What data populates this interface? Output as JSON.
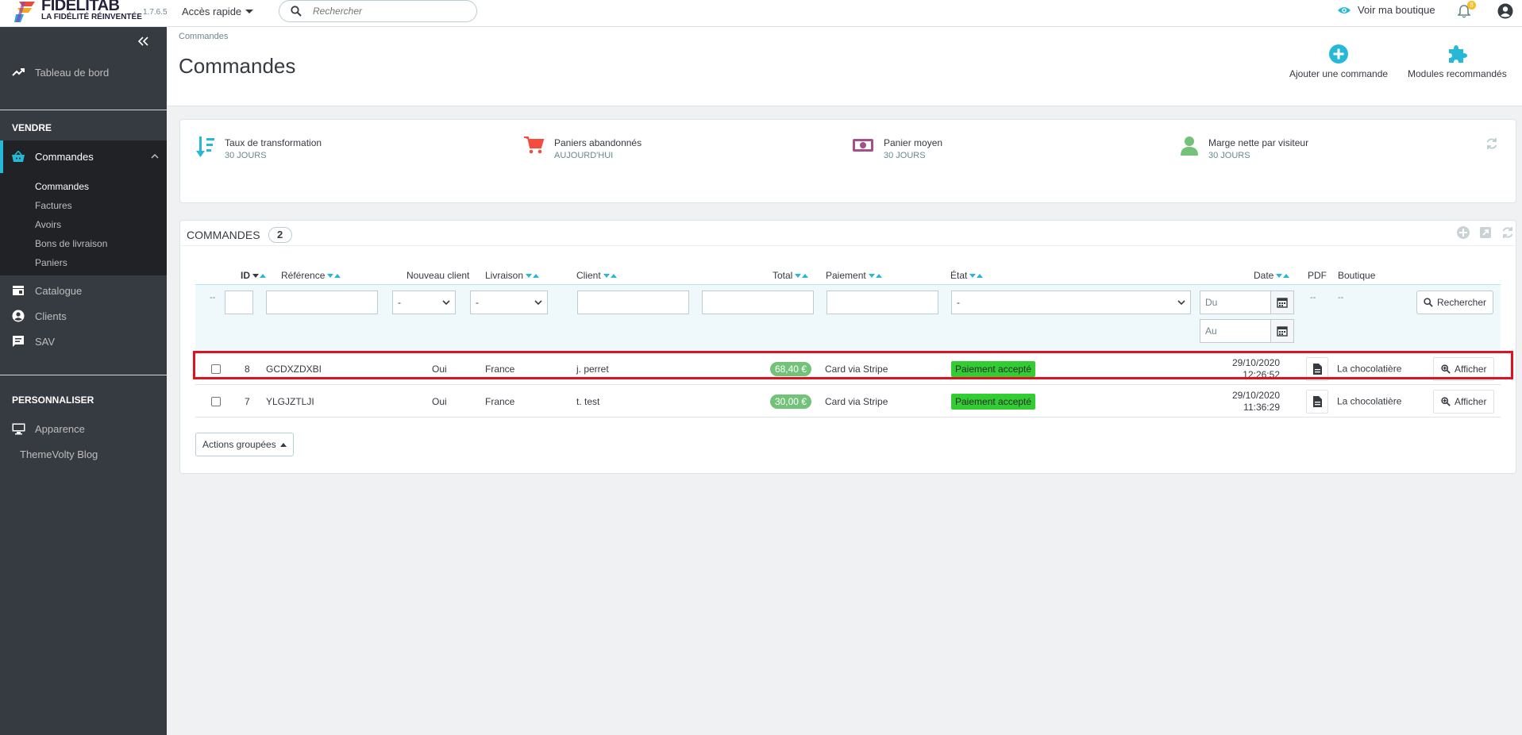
{
  "app": {
    "logo_title": "FIDELITAB",
    "logo_tagline": "LA FIDÉLITÉ RÉINVENTÉE",
    "version": "1.7.6.5",
    "quick_access": "Accès rapide",
    "search_placeholder": "Rechercher",
    "view_shop": "Voir ma boutique",
    "notifications_count": "8"
  },
  "sidebar": {
    "dashboard": "Tableau de bord",
    "section_sell": "VENDRE",
    "orders": "Commandes",
    "sub": [
      "Commandes",
      "Factures",
      "Avoirs",
      "Bons de livraison",
      "Paniers"
    ],
    "catalog": "Catalogue",
    "customers": "Clients",
    "sav": "SAV",
    "section_customize": "PERSONNALISER",
    "appearance": "Apparence",
    "blog": "ThemeVolty Blog"
  },
  "header": {
    "breadcrumb": "Commandes",
    "title": "Commandes",
    "add_order": "Ajouter une commande",
    "modules": "Modules recommandés"
  },
  "kpis": [
    {
      "label": "Taux de transformation",
      "period": "30 JOURS"
    },
    {
      "label": "Paniers abandonnés",
      "period": "AUJOURD'HUI"
    },
    {
      "label": "Panier moyen",
      "period": "30 JOURS"
    },
    {
      "label": "Marge nette par visiteur",
      "period": "30 JOURS"
    }
  ],
  "orders_panel": {
    "title": "COMMANDES",
    "count": "2",
    "columns": {
      "id": "ID",
      "reference": "Référence",
      "new_client": "Nouveau client",
      "delivery": "Livraison",
      "client": "Client",
      "total": "Total",
      "payment": "Paiement",
      "state": "État",
      "date": "Date",
      "pdf": "PDF",
      "shop": "Boutique"
    },
    "filters": {
      "dash": "--",
      "select_default": "-",
      "date_from": "Du",
      "date_to": "Au",
      "search_button": "Rechercher"
    },
    "rows": [
      {
        "id": "8",
        "reference": "GCDXZDXBI",
        "new_client": "Oui",
        "delivery": "France",
        "client": "j. perret",
        "total": "68,40 €",
        "payment": "Card via Stripe",
        "state": "Paiement accepté",
        "date": "29/10/2020",
        "time": "12:26:52",
        "shop": "La chocolatière",
        "view": "Afficher"
      },
      {
        "id": "7",
        "reference": "YLGJZTLJI",
        "new_client": "Oui",
        "delivery": "France",
        "client": "t. test",
        "total": "30,00 €",
        "payment": "Card via Stripe",
        "state": "Paiement accepté",
        "date": "29/10/2020",
        "time": "11:36:29",
        "shop": "La chocolatière",
        "view": "Afficher"
      }
    ],
    "bulk_actions": "Actions groupées"
  },
  "colors": {
    "accent": "#25b9d7",
    "sidebar_bg": "#363a41",
    "total_badge": "#72c279",
    "state_badge": "#32cd32",
    "highlight": "#e0121f"
  }
}
